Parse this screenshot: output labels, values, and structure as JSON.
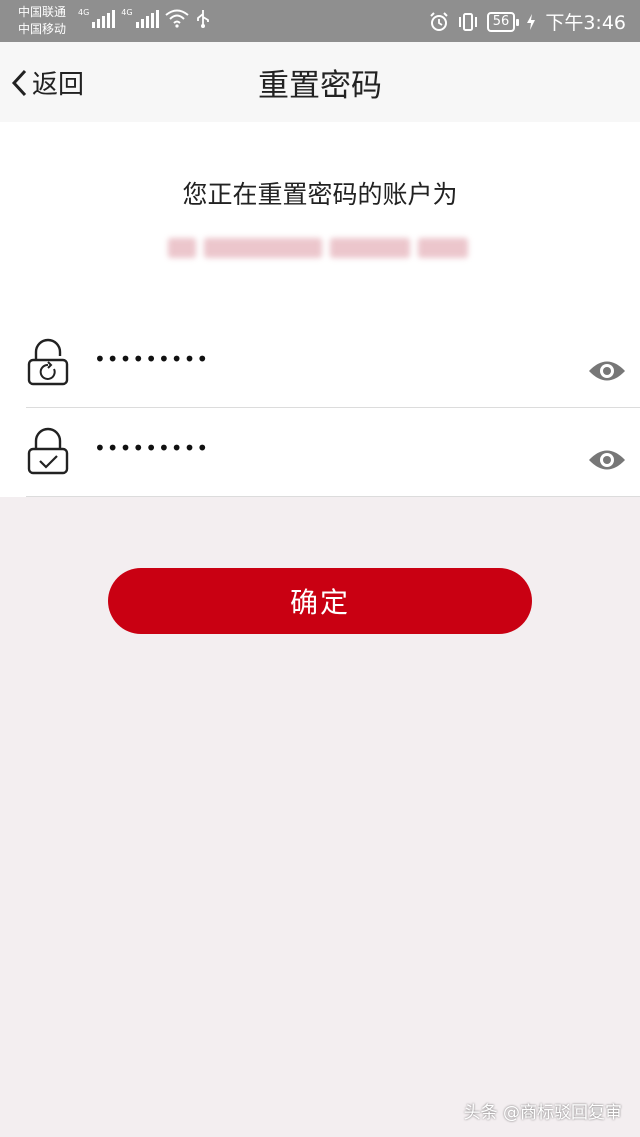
{
  "status_bar": {
    "carrier_1": "中国联通",
    "carrier_2": "中国移动",
    "network_1": "4G",
    "network_2": "4G",
    "battery": "56",
    "time": "下午3:46"
  },
  "nav": {
    "back_label": "返回",
    "title": "重置密码"
  },
  "account": {
    "intro_text": "您正在重置密码的账户为"
  },
  "password_fields": [
    {
      "value": "123456789",
      "icon": "lock-refresh-icon"
    },
    {
      "value": "123456789",
      "icon": "lock-check-icon"
    }
  ],
  "confirm_button": {
    "label": "确定"
  },
  "watermark": "头条 @商标驳回复审",
  "colors": {
    "accent": "#c90012",
    "background": "#f3eef0",
    "status_bar": "#8f8f8f"
  }
}
